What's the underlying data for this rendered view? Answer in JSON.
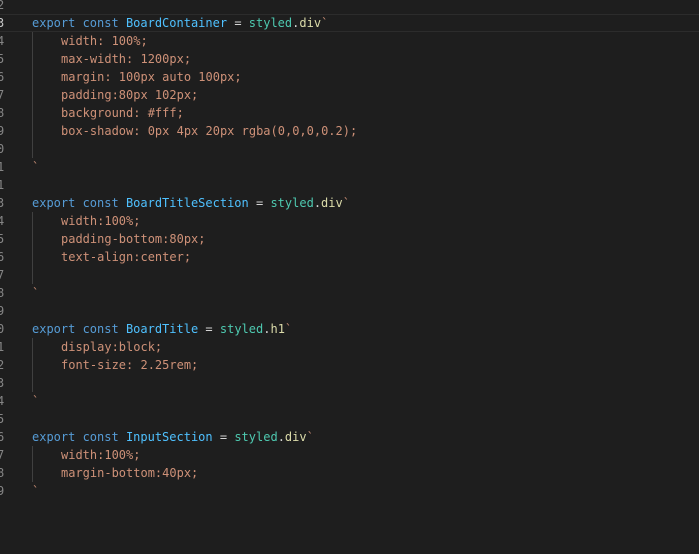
{
  "editor": {
    "colors": {
      "background": "#1e1e1e",
      "line_number": "#858585",
      "keyword": "#569cd6",
      "constant_name": "#4fc1ff",
      "object": "#4ec9b0",
      "method": "#dcdcaa",
      "template_string": "#ce9178"
    },
    "lines": [
      {
        "number": "2"
      },
      {
        "number": "3",
        "keyword": "export const",
        "name": "BoardContainer",
        "op": " = ",
        "object": "styled",
        "dot": ".",
        "tag": "div",
        "tick": "`"
      },
      {
        "number": "4",
        "css": "width: 100%;"
      },
      {
        "number": "5",
        "css": "max-width: 1200px;"
      },
      {
        "number": "6",
        "css": "margin: 100px auto 100px;"
      },
      {
        "number": "7",
        "css": "padding:80px 102px;"
      },
      {
        "number": "8",
        "css": "background: #fff;"
      },
      {
        "number": "9",
        "css": "box-shadow: 0px 4px 20px rgba(0,0,0,0.2);"
      },
      {
        "number": "0"
      },
      {
        "number": "1",
        "tick": "`"
      },
      {
        "number": "1"
      },
      {
        "number": "3",
        "keyword": "export const",
        "name": "BoardTitleSection",
        "op": " = ",
        "object": "styled",
        "dot": ".",
        "tag": "div",
        "tick": "`"
      },
      {
        "number": "4",
        "css": "width:100%;"
      },
      {
        "number": "5",
        "css": "padding-bottom:80px;"
      },
      {
        "number": "6",
        "css": "text-align:center;"
      },
      {
        "number": "7"
      },
      {
        "number": "8",
        "tick": "`"
      },
      {
        "number": "9"
      },
      {
        "number": "0",
        "keyword": "export const",
        "name": "BoardTitle",
        "op": " = ",
        "object": "styled",
        "dot": ".",
        "tag": "h1",
        "tick": "`"
      },
      {
        "number": "1",
        "css": "display:block;"
      },
      {
        "number": "2",
        "css": "font-size: 2.25rem;"
      },
      {
        "number": "3"
      },
      {
        "number": "4",
        "tick": "`"
      },
      {
        "number": "5"
      },
      {
        "number": "6",
        "keyword": "export const",
        "name": "InputSection",
        "op": " = ",
        "object": "styled",
        "dot": ".",
        "tag": "div",
        "tick": "`"
      },
      {
        "number": "7",
        "css": "width:100%;"
      },
      {
        "number": "8",
        "css": "margin-bottom:40px;"
      },
      {
        "number": "9",
        "tick": "`"
      }
    ]
  }
}
